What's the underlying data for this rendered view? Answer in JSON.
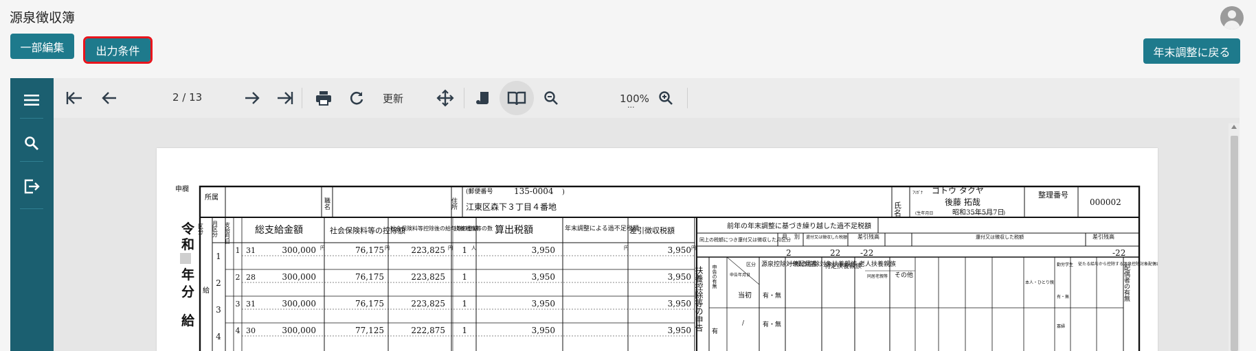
{
  "app": {
    "title": "源泉徴収簿"
  },
  "actions": {
    "partial_edit": "一部編集",
    "output_conditions": "出力条件",
    "back_to_year_end": "年末調整に戻る"
  },
  "toolbar": {
    "page_indicator": "2 / 13",
    "refresh_label": "更新",
    "zoom_level": "100%",
    "zoom_menu": "..."
  },
  "sidebar_icons": [
    "menu-icon",
    "search-icon",
    "export-icon"
  ],
  "document": {
    "header": {
      "applicant_col": "申欄",
      "affiliation": "所属",
      "job": "職名",
      "address_label": "住所",
      "postal_label": "(郵便番号",
      "postal_code": "135-0004",
      "postal_close": ")",
      "address": "江東区森下３丁目４番地",
      "name_label": "氏名",
      "furigana_label": "ﾌﾘｶﾞﾅ",
      "furigana": "ゴトウ タクヤ",
      "name": "後藤 拓哉",
      "birth_label": "(生年月日",
      "birth": "昭和35年5月7日",
      "birth_close": ")",
      "serial_label": "整理番号",
      "serial": "000002"
    },
    "era_vertical": [
      "令",
      "和",
      "",
      "年",
      "分",
      "給"
    ],
    "era_block": "",
    "columns": {
      "kubun": "区分",
      "month_kubun": "月区分",
      "pay_date": "支給月日",
      "total_pay": "総支給金額",
      "social_ins": "社会保険料等の控除額",
      "after_deduction": "社会保険料等控除後の給与等の金額",
      "dependents": "扶養親族等の数",
      "tax": "算出税額",
      "year_end_shortfall": "年末調整による過不足税額",
      "withheld": "差引徴収税額"
    },
    "salary_label": "給",
    "rows": [
      {
        "mk": "1",
        "m": "1",
        "d": "31",
        "total": "300,000",
        "ins": "76,175",
        "after": "223,825",
        "dep": "1",
        "tax": "3,950",
        "withheld": "3,950"
      },
      {
        "mk": "2",
        "m": "2",
        "d": "28",
        "total": "300,000",
        "ins": "76,175",
        "after": "223,825",
        "dep": "1",
        "tax": "3,950",
        "withheld": "3,950"
      },
      {
        "mk": "3",
        "m": "3",
        "d": "31",
        "total": "300,000",
        "ins": "76,175",
        "after": "223,825",
        "dep": "1",
        "tax": "3,950",
        "withheld": "3,950"
      },
      {
        "mk": "4",
        "m": "4",
        "d": "30",
        "total": "300,000",
        "ins": "77,125",
        "after": "222,875",
        "dep": "1",
        "tax": "3,950",
        "withheld": "3,950"
      }
    ],
    "unit_yen": "円",
    "unit_person": "人",
    "right": {
      "prev_year_title": "前年の年末調整に基づき繰り越した過不足税額",
      "same_above": "同上の税額につき還付又は徴収した月区分",
      "month_label": "月",
      "separate_label": "別",
      "refund_label": "還付又は徴収した税額",
      "diff_label": "差引残高",
      "month_val": "2",
      "amt1": "22",
      "diff1": "-22",
      "diff2": "-22",
      "deduct_vertical": "扶養控除等の申告",
      "declare_label": "申告の有無",
      "kubun_label": "区分",
      "decl_month": "申告年月日",
      "withholding_spouse": "源泉控除対象配偶者",
      "general_dep": "一般の控除対象扶養親族",
      "specific_dep": "特定扶養親族",
      "elderly_dep": "老人扶養親族",
      "living_together": "同居老親等",
      "other": "その他",
      "initial": "当初",
      "yes_no": "有・無",
      "has": "有",
      "slash": "/",
      "people_small": "人",
      "spouse_vertical": "配偶者の有無",
      "reduction_text": "従たる給与から控除する源泉控除対象配偶者と控除対象扶養親族の合計数",
      "working_student": "勤労学生",
      "person_combo": "本人・ひとり親",
      "person_yes": "有・無",
      "widow": "寡婦"
    }
  }
}
